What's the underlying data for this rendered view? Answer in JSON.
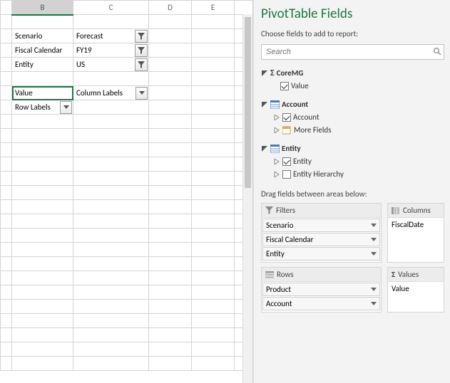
{
  "sheet": {
    "columns": [
      "B",
      "C",
      "D",
      "E"
    ],
    "selected_column": "B",
    "filters": {
      "scenario": {
        "label": "Scenario",
        "value": "Forecast"
      },
      "fiscal": {
        "label": "Fiscal Calendar",
        "value": "FY19"
      },
      "entity": {
        "label": "Entity",
        "value": "US"
      }
    },
    "pivot_headers": {
      "value": "Value",
      "column_labels": "Column Labels",
      "row_labels": "Row Labels"
    }
  },
  "panel": {
    "title": "PivotTable Fields",
    "subtitle": "Choose fields to add to report:",
    "search_placeholder": "Search",
    "tree": {
      "coremg": {
        "label": "CoreMG",
        "value_label": "Value",
        "value_checked": true
      },
      "account": {
        "label": "Account",
        "field_label": "Account",
        "field_checked": true,
        "more_fields": "More Fields"
      },
      "entity": {
        "label": "Entity",
        "field_label": "Entity",
        "field_checked": true,
        "hierarchy_label": "Entity Hierarchy",
        "hierarchy_checked": false
      }
    },
    "drag_hint": "Drag fields between areas below:",
    "areas": {
      "filters": {
        "title": "Filters",
        "items": [
          "Scenario",
          "Fiscal Calendar",
          "Entity"
        ]
      },
      "columns": {
        "title": "Columns",
        "items": [
          "FiscalDate"
        ]
      },
      "rows": {
        "title": "Rows",
        "items": [
          "Product",
          "Account"
        ]
      },
      "values": {
        "title": "Values",
        "items": [
          "Value"
        ]
      }
    }
  }
}
